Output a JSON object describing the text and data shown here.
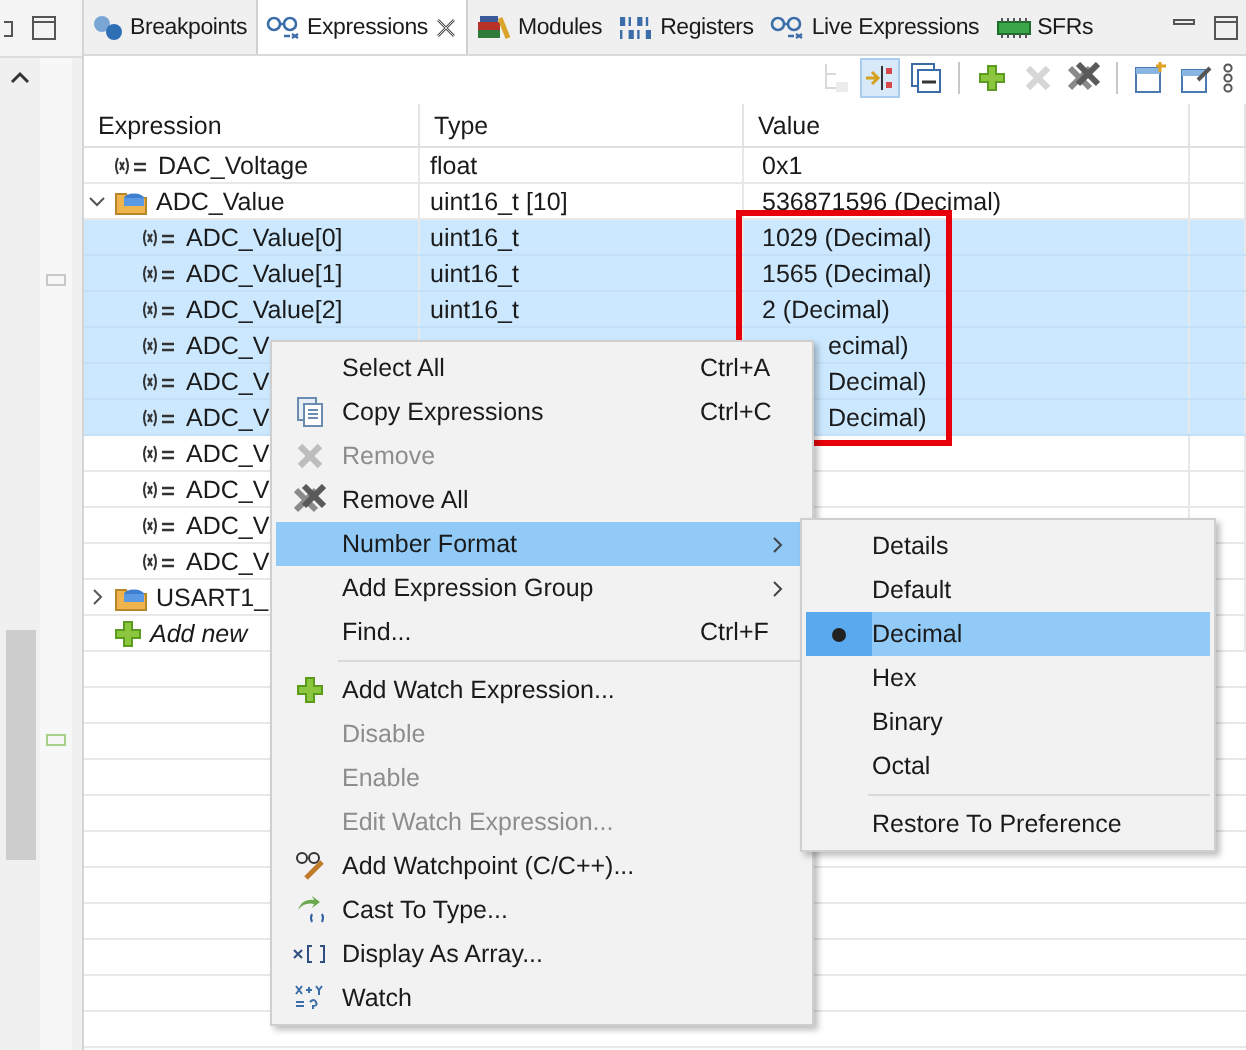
{
  "tabs": [
    {
      "label": "Breakpoints",
      "selected": false,
      "kind": "breakpoints"
    },
    {
      "label": "Expressions",
      "selected": true,
      "kind": "expressions"
    },
    {
      "label": "Modules",
      "selected": false,
      "kind": "modules"
    },
    {
      "label": "Registers",
      "selected": false,
      "kind": "registers"
    },
    {
      "label": "Live Expressions",
      "selected": false,
      "kind": "expressions"
    },
    {
      "label": "SFRs",
      "selected": false,
      "kind": "sfrs"
    }
  ],
  "toolbar": [
    {
      "kind": "icon",
      "disabled": true
    },
    {
      "kind": "icon",
      "disabled": false,
      "selected": true
    },
    {
      "kind": "icon",
      "disabled": false,
      "selected": false
    },
    {
      "kind": "separator"
    },
    {
      "kind": "icon",
      "disabled": false,
      "selected": false
    },
    {
      "kind": "icon",
      "disabled": true
    },
    {
      "kind": "icon",
      "disabled": false,
      "selected": false
    },
    {
      "kind": "separator"
    },
    {
      "kind": "icon",
      "disabled": false,
      "selected": false
    },
    {
      "kind": "icon",
      "disabled": false,
      "selected": false
    }
  ],
  "columns": [
    "Expression",
    "Type",
    "Value"
  ],
  "rows": [
    {
      "kind": "variable",
      "expression": "DAC_Voltage",
      "type": "float",
      "value": "0x1",
      "selected": false
    },
    {
      "kind": "group",
      "expression": "ADC_Value",
      "type": "uint16_t [10]",
      "value": "536871596 (Decimal)",
      "selected": false,
      "expanded": true,
      "children": [
        {
          "kind": "variable",
          "expression": "ADC_Value[0]",
          "type": "uint16_t",
          "value": "1029 (Decimal)",
          "selected": true
        },
        {
          "kind": "variable",
          "expression": "ADC_Value[1]",
          "type": "uint16_t",
          "value": "1565 (Decimal)",
          "selected": true
        },
        {
          "kind": "variable",
          "expression": "ADC_Value[2]",
          "type": "uint16_t",
          "value": "2 (Decimal)",
          "selected": true
        },
        {
          "kind": "variable",
          "expression": "ADC_V",
          "value": "ecimal)",
          "selected": true,
          "covered": true
        },
        {
          "kind": "variable",
          "expression": "ADC_V",
          "value": "Decimal)",
          "selected": true,
          "covered": true
        },
        {
          "kind": "variable",
          "expression": "ADC_V",
          "value": "Decimal)",
          "selected": true,
          "covered": true
        },
        {
          "kind": "variable",
          "expression": "ADC_V",
          "selected": false
        },
        {
          "kind": "variable",
          "expression": "ADC_V",
          "selected": false
        },
        {
          "kind": "variable",
          "expression": "ADC_V",
          "selected": false
        },
        {
          "kind": "variable",
          "expression": "ADC_V",
          "selected": false
        }
      ]
    },
    {
      "kind": "group",
      "expression": "USART1_",
      "selected": false,
      "expanded": false
    },
    {
      "kind": "add",
      "expression": "Add new",
      "selected": false
    }
  ],
  "context_menu": [
    {
      "kind": "item",
      "label": "Select All",
      "shortcut": "Ctrl+A",
      "disabled": false,
      "selected": false
    },
    {
      "kind": "item",
      "label": "Copy Expressions",
      "shortcut": "Ctrl+C",
      "disabled": false,
      "selected": false
    },
    {
      "kind": "item",
      "label": "Remove",
      "disabled": true,
      "selected": false
    },
    {
      "kind": "item",
      "label": "Remove All",
      "disabled": false,
      "selected": false
    },
    {
      "kind": "submenu",
      "label": "Number Format",
      "disabled": false,
      "selected": true
    },
    {
      "kind": "submenu",
      "label": "Add Expression Group",
      "disabled": false,
      "selected": false
    },
    {
      "kind": "item",
      "label": "Find...",
      "shortcut": "Ctrl+F",
      "disabled": false,
      "selected": false
    },
    {
      "kind": "separator"
    },
    {
      "kind": "item",
      "label": "Add Watch Expression...",
      "disabled": false,
      "selected": false
    },
    {
      "kind": "item",
      "label": "Disable",
      "disabled": true,
      "selected": false
    },
    {
      "kind": "item",
      "label": "Enable",
      "disabled": true,
      "selected": false
    },
    {
      "kind": "item",
      "label": "Edit Watch Expression...",
      "disabled": true,
      "selected": false
    },
    {
      "kind": "item",
      "label": "Add Watchpoint (C/C++)...",
      "disabled": false,
      "selected": false
    },
    {
      "kind": "item",
      "label": "Cast To Type...",
      "disabled": false,
      "selected": false
    },
    {
      "kind": "item",
      "label": "Display As Array...",
      "disabled": false,
      "selected": false
    },
    {
      "kind": "item",
      "label": "Watch",
      "disabled": false,
      "selected": false
    }
  ],
  "number_format_menu": [
    {
      "kind": "item",
      "label": "Details",
      "selected": false
    },
    {
      "kind": "item",
      "label": "Default",
      "selected": false
    },
    {
      "kind": "item",
      "label": "Decimal",
      "selected": true
    },
    {
      "kind": "item",
      "label": "Hex",
      "selected": false
    },
    {
      "kind": "item",
      "label": "Binary",
      "selected": false
    },
    {
      "kind": "item",
      "label": "Octal",
      "selected": false
    },
    {
      "kind": "separator"
    },
    {
      "kind": "item",
      "label": "Restore To Preference",
      "selected": false
    }
  ]
}
